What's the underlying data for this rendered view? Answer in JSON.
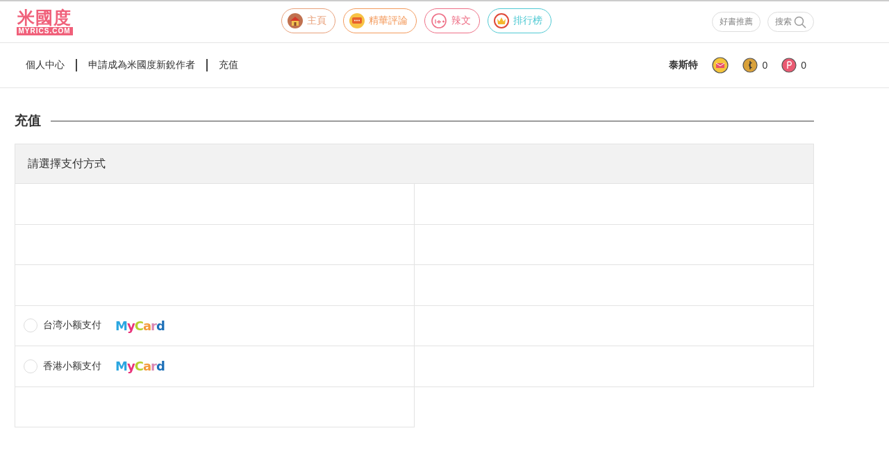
{
  "logo": {
    "title": "米國度",
    "domain": "MYRICS.COM"
  },
  "nav": [
    {
      "label": "主頁",
      "kind": "home"
    },
    {
      "label": "精華評論",
      "kind": "review"
    },
    {
      "label": "辣文",
      "kind": "adult"
    },
    {
      "label": "排行榜",
      "kind": "rank"
    }
  ],
  "header_right": {
    "recommend": "好書推薦",
    "search": "搜索"
  },
  "breadcrumb": [
    "個人中心",
    "申請成為米國度新銳作者",
    "充值"
  ],
  "user": {
    "name": "泰斯特",
    "coins": "0",
    "points": "0"
  },
  "section_title": "充值",
  "panel_title": "請選擇支付方式",
  "payment_options": [
    {
      "label": "台湾小额支付",
      "logo": "MyCard",
      "selected": false
    },
    {
      "label": "香港小额支付",
      "logo": "MyCard",
      "selected": false
    }
  ]
}
